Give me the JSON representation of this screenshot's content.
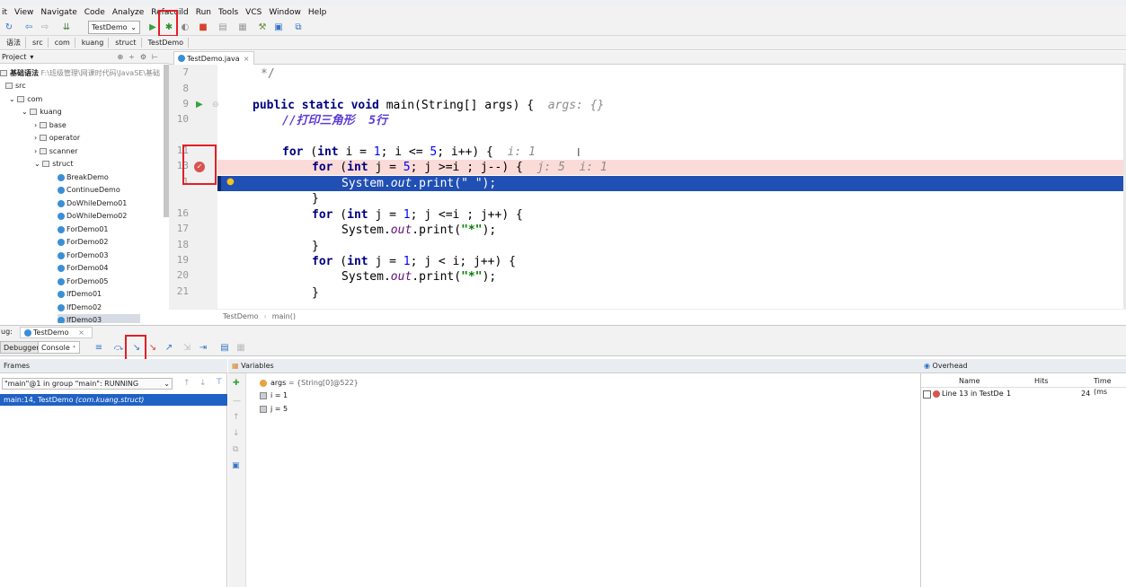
{
  "menu": [
    "it",
    "View",
    "Navigate",
    "Code",
    "Analyze",
    "Refac",
    "uild",
    "Run",
    "Tools",
    "VCS",
    "Window",
    "Help"
  ],
  "toolbar": {
    "run_config": "TestDemo"
  },
  "breadcrumb": [
    "语法",
    "src",
    "com",
    "kuang",
    "struct",
    "TestDemo"
  ],
  "project": {
    "header": "Project",
    "root_label": "基础语法",
    "root_path": "F:\\班级管理\\网课时代码\\JavaSE\\基础",
    "items": [
      "src",
      "com",
      "kuang",
      "base",
      "operator",
      "scanner",
      "struct",
      "BreakDemo",
      "ContinueDemo",
      "DoWhileDemo01",
      "DoWhileDemo02",
      "ForDemo01",
      "ForDemo02",
      "ForDemo03",
      "ForDemo04",
      "ForDemo05",
      "IfDemo01",
      "IfDemo02",
      "IfDemo03"
    ]
  },
  "editor": {
    "tab": "TestDemo.java",
    "line_numbers": [
      "7",
      "8",
      "9",
      "10",
      "11",
      "13",
      "1",
      "16",
      "17",
      "18",
      "19",
      "20",
      "21"
    ],
    "lines": {
      "l7": "*/",
      "l9_kw": "public static void",
      "l9_rest": " main(String[] args) {",
      "l9_hint": "args: {}",
      "l10": "//打印三角形  5行",
      "l12_kw1": "for",
      "l12_kw2": "int",
      "l12_a": " (",
      "l12_b": " i = ",
      "l12_n1": "1",
      "l12_c": "; i <= ",
      "l12_n2": "5",
      "l12_d": "; i++) {",
      "l12_hint": "i: 1",
      "l13_kw1": "for",
      "l13_kw2": "int",
      "l13_a": " (",
      "l13_b": " j = ",
      "l13_n1": "5",
      "l13_c": "; j >=i ; j--) {",
      "l13_hint": "j: 5  i: 1",
      "l14_a": "System.",
      "l14_fld": "out",
      "l14_b": ".print(\" \");",
      "l15": "}",
      "l16_kw1": "for",
      "l16_kw2": "int",
      "l16_a": " (",
      "l16_b": " j = ",
      "l16_n1": "1",
      "l16_c": "; j <=i ; j++) {",
      "l17_a": "System.",
      "l17_fld": "out",
      "l17_b": ".print(",
      "l17_str": "\"*\"",
      "l17_c": ");",
      "l18": "}",
      "l19_kw1": "for",
      "l19_kw2": "int",
      "l19_a": " (",
      "l19_b": " j = ",
      "l19_n1": "1",
      "l19_c": "; j < i; j++) {",
      "l20_a": "System.",
      "l20_fld": "out",
      "l20_b": ".print(",
      "l20_str": "\"*\"",
      "l20_c": ");",
      "l21": "}"
    },
    "crumb_class": "TestDemo",
    "crumb_method": "main()"
  },
  "debug": {
    "label": "ug:",
    "session_tab": "TestDemo",
    "tab_debugger": "Debugger",
    "tab_console": "Console",
    "frames_title": "Frames",
    "thread": "\"main\"@1 in group \"main\": RUNNING",
    "frame": "main:14, TestDemo",
    "frame_pkg": "(com.kuang.struct)",
    "variables_title": "Variables",
    "variables": [
      {
        "name": "args",
        "value": " = {String[0]@522}"
      },
      {
        "name": "i",
        "value": " = 1"
      },
      {
        "name": "j",
        "value": " = 5"
      }
    ],
    "overhead_title": "Overhead",
    "overhead_cols": [
      "Name",
      "Hits",
      "Time (ms"
    ],
    "overhead_row": {
      "name": "Line 13 in TestDe",
      "hits": "1",
      "time": "24"
    }
  },
  "colors": {
    "breakpoint_line": "#fadbd8",
    "execution_line": "#2150b5",
    "keyword": "#000080",
    "comment": "#5c3bd6",
    "string": "#008000",
    "highlight_box": "#e21f26"
  }
}
